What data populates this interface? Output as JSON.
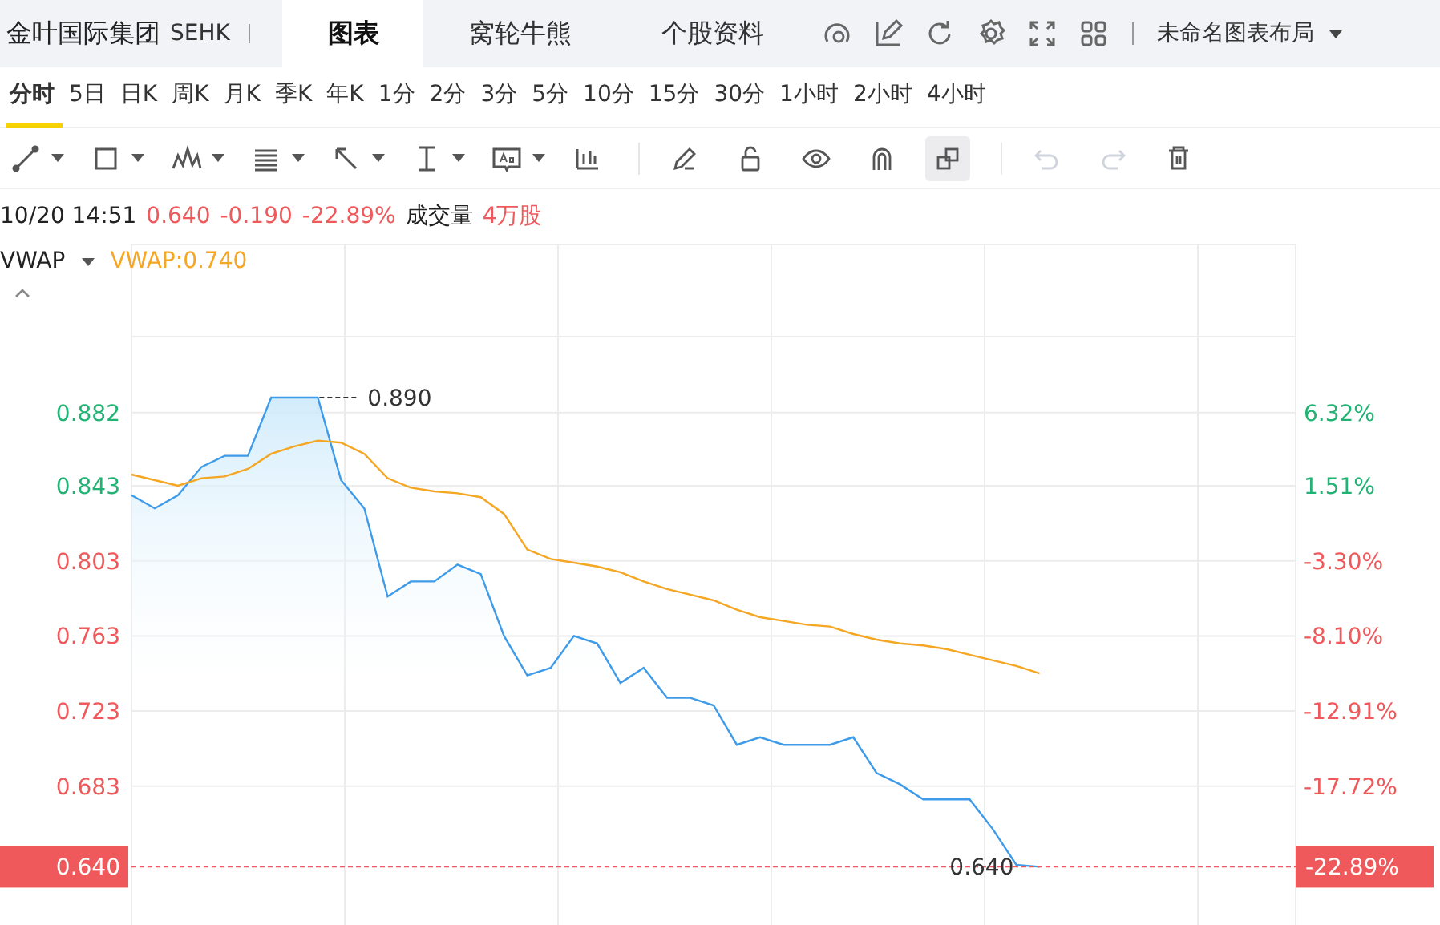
{
  "header": {
    "stock_name": "金叶国际集团",
    "exchange": "SEHK",
    "tabs": [
      {
        "label": "图表",
        "selected": true
      },
      {
        "label": "窝轮牛熊",
        "selected": false
      },
      {
        "label": "个股资料",
        "selected": false
      }
    ],
    "layout_name": "未命名图表布局"
  },
  "periods": [
    {
      "label": "分时",
      "selected": true
    },
    {
      "label": "5日",
      "selected": false
    },
    {
      "label": "日K",
      "selected": false
    },
    {
      "label": "周K",
      "selected": false
    },
    {
      "label": "月K",
      "selected": false
    },
    {
      "label": "季K",
      "selected": false
    },
    {
      "label": "年K",
      "selected": false
    },
    {
      "label": "1分",
      "selected": false
    },
    {
      "label": "2分",
      "selected": false
    },
    {
      "label": "3分",
      "selected": false
    },
    {
      "label": "5分",
      "selected": false
    },
    {
      "label": "10分",
      "selected": false
    },
    {
      "label": "15分",
      "selected": false
    },
    {
      "label": "30分",
      "selected": false
    },
    {
      "label": "1小时",
      "selected": false
    },
    {
      "label": "2小时",
      "selected": false
    },
    {
      "label": "4小时",
      "selected": false
    }
  ],
  "drawing_tools": [
    {
      "has_menu": true
    },
    {
      "has_menu": true
    },
    {
      "has_menu": true
    },
    {
      "has_menu": true
    },
    {
      "has_menu": true
    },
    {
      "has_menu": true
    },
    {
      "has_menu": true
    },
    {
      "has_menu": false
    }
  ],
  "edit_tools": [
    {
      "selected": false,
      "disabled": false
    },
    {
      "selected": false,
      "disabled": false
    },
    {
      "selected": false,
      "disabled": false
    },
    {
      "selected": false,
      "disabled": false
    },
    {
      "selected": true,
      "disabled": false
    },
    {
      "selected": false,
      "disabled": true
    },
    {
      "selected": false,
      "disabled": true
    },
    {
      "selected": false,
      "disabled": false
    }
  ],
  "quote": {
    "time": "10/20 14:51",
    "price": "0.640",
    "change": "-0.190",
    "change_percent": "-22.89%",
    "volume_label": "成交量",
    "volume": "4万股"
  },
  "indicator": {
    "value": "VWAP:0.740"
  },
  "chart": {
    "right_axis_labels": [
      "6.32%",
      "1.51%",
      "-3.30%",
      "-8.10%",
      "-12.91%",
      "-17.72%",
      "-22.89%"
    ],
    "chart_data": {
      "type": "line",
      "grid": true,
      "categories": [
        null,
        null,
        null,
        null,
        null,
        null,
        null,
        null,
        null,
        null,
        null,
        null,
        null,
        null,
        null,
        null,
        null,
        null,
        null,
        null,
        null,
        null,
        null,
        null,
        null,
        null,
        null,
        null,
        null,
        null,
        null,
        null,
        null,
        null,
        null,
        null,
        null,
        null,
        null,
        null,
        null,
        null,
        null,
        null,
        null,
        null,
        null,
        null,
        null,
        null
      ],
      "ylim": [
        0.609,
        0.972
      ],
      "yticks": [
        {
          "value": 0.882,
          "label": "0.882"
        },
        {
          "value": 0.843,
          "label": "0.843"
        },
        {
          "value": 0.803,
          "label": "0.803"
        },
        {
          "value": 0.763,
          "label": "0.763"
        },
        {
          "value": 0.723,
          "label": "0.723"
        },
        {
          "value": 0.683,
          "label": "0.683"
        },
        {
          "value": 0.64,
          "label": "0.640"
        }
      ],
      "series": [
        {
          "type": "area",
          "color": "#3d9be9",
          "values": [
            0.838,
            0.831,
            0.838,
            0.853,
            0.859,
            0.859,
            0.89,
            0.89,
            0.89,
            0.846,
            0.831,
            0.784,
            0.792,
            0.792,
            0.801,
            0.796,
            0.763,
            0.742,
            0.746,
            0.763,
            0.759,
            0.738,
            0.746,
            0.73,
            0.73,
            0.726,
            0.705,
            0.709,
            0.705,
            0.705,
            0.705,
            0.709,
            0.69,
            0.684,
            0.676,
            0.676,
            0.676,
            0.66,
            0.641,
            0.64,
            null,
            null,
            null,
            null,
            null,
            null,
            null,
            null,
            null,
            null
          ]
        },
        {
          "name": "VWAP",
          "color": "#f5a623",
          "values": [
            0.849,
            0.846,
            0.843,
            0.847,
            0.848,
            0.852,
            0.86,
            0.864,
            0.867,
            0.866,
            0.86,
            0.847,
            0.842,
            0.84,
            0.839,
            0.837,
            0.828,
            0.809,
            0.804,
            0.802,
            0.8,
            0.797,
            0.792,
            0.788,
            0.785,
            0.782,
            0.777,
            0.773,
            0.771,
            0.769,
            0.768,
            0.764,
            0.761,
            0.759,
            0.758,
            0.756,
            0.753,
            0.75,
            0.747,
            0.743,
            null,
            null,
            null,
            null,
            null,
            null,
            null,
            null,
            null,
            null
          ]
        }
      ],
      "annotations": [
        "0.890"
      ],
      "ref_lines": [
        {
          "axis": "y",
          "value": 0.64,
          "label": "0.640"
        }
      ]
    }
  }
}
